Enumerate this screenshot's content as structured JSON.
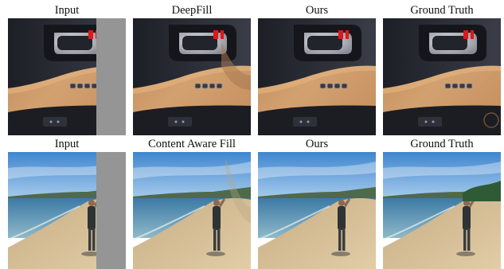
{
  "rows": [
    {
      "scene": "car-door-interior",
      "captions": [
        "Input",
        "DeepFill",
        "Ours",
        "Ground Truth"
      ]
    },
    {
      "scene": "beach-person",
      "captions": [
        "Input",
        "Content Aware Fill",
        "Ours",
        "Ground Truth"
      ]
    }
  ],
  "colors": {
    "mask_gray": "#959595",
    "leather_tan": "#c99566",
    "door_dark": "#2a2c33",
    "sky_blue": "#6aa6dd",
    "water_blue": "#4c8bb3",
    "sand": "#d2b88f"
  }
}
